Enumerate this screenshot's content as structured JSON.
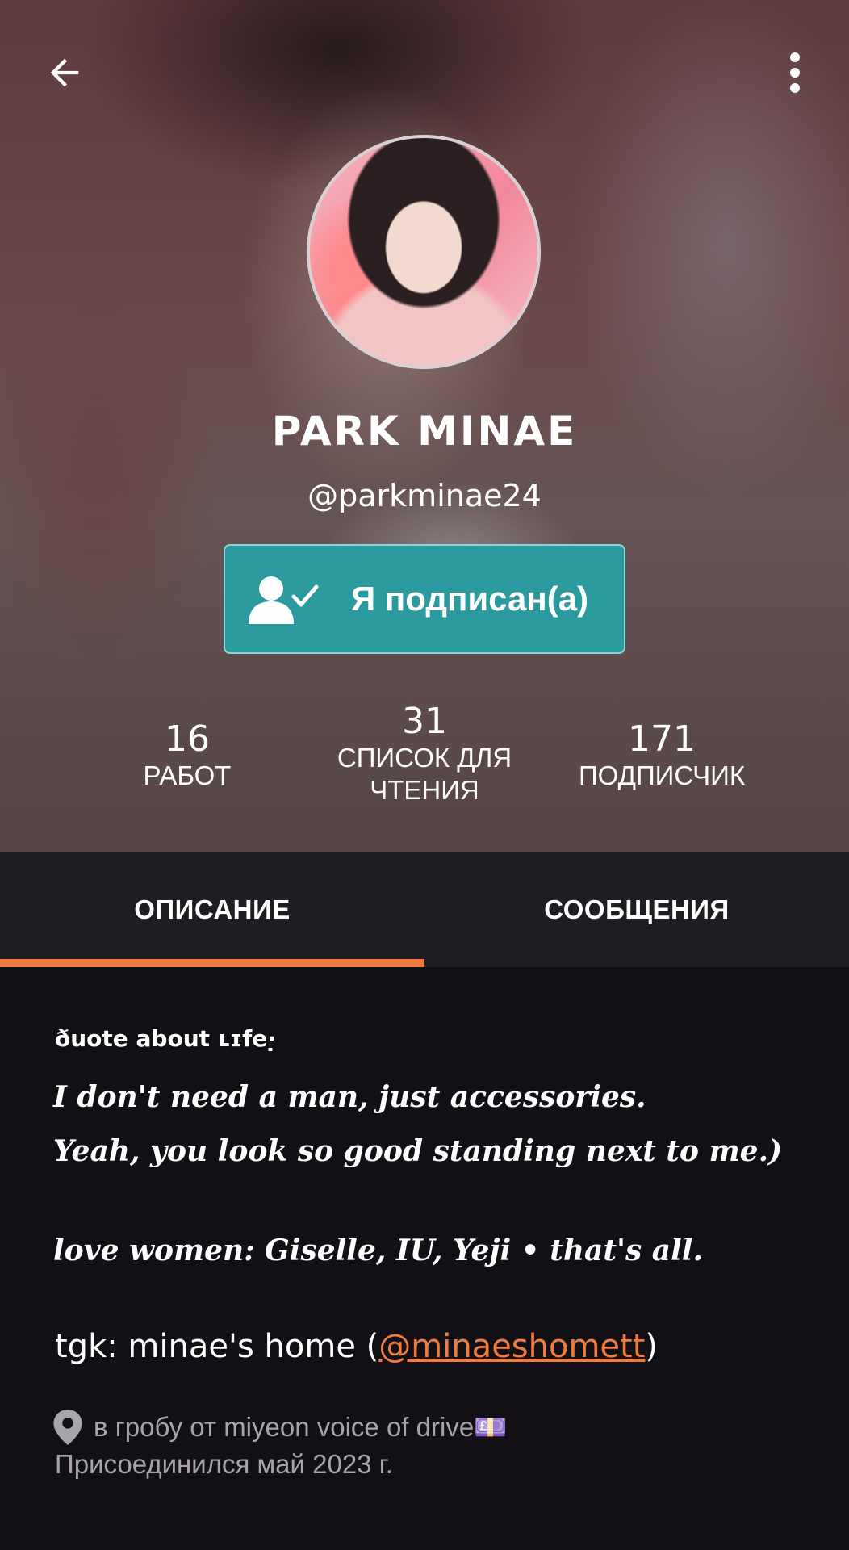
{
  "profile": {
    "display_name": "PARK MINAE",
    "username": "@parkminae24",
    "follow_label": "Я подписан(а)"
  },
  "stats": [
    {
      "value": "16",
      "label": "РАБОТ"
    },
    {
      "value": "31",
      "label": "СПИСОК ДЛЯ ЧТЕНИЯ"
    },
    {
      "value": "171",
      "label": "ПОДПИСЧИК"
    }
  ],
  "tabs": [
    {
      "label": "ОПИСАНИЕ",
      "active": true
    },
    {
      "label": "СООБЩЕНИЯ",
      "active": false
    }
  ],
  "about": {
    "quote_heading": "ðuote about ʟɪfe·̣",
    "bio_lines": [
      "I don't need a man, just accessories.",
      "Yeah, you look so good standing next to me.)",
      "love women: Giselle, IU, Yeji • that's all."
    ],
    "tgk_prefix": "tgk: minae's home (",
    "tgk_link": "@minaeshomett",
    "tgk_suffix": ")",
    "location": "в гробу от miyeon voice of drive💷",
    "joined": "Присоединился май 2023 г."
  },
  "icons": {
    "back": "arrow-back-icon",
    "menu": "more-vert-icon",
    "follow": "user-check-icon",
    "location": "location-pin-icon"
  },
  "colors": {
    "accent": "#f07b3f",
    "follow_button": "#2a9a9e",
    "background": "#121014",
    "tabbar": "#1f1d21"
  }
}
